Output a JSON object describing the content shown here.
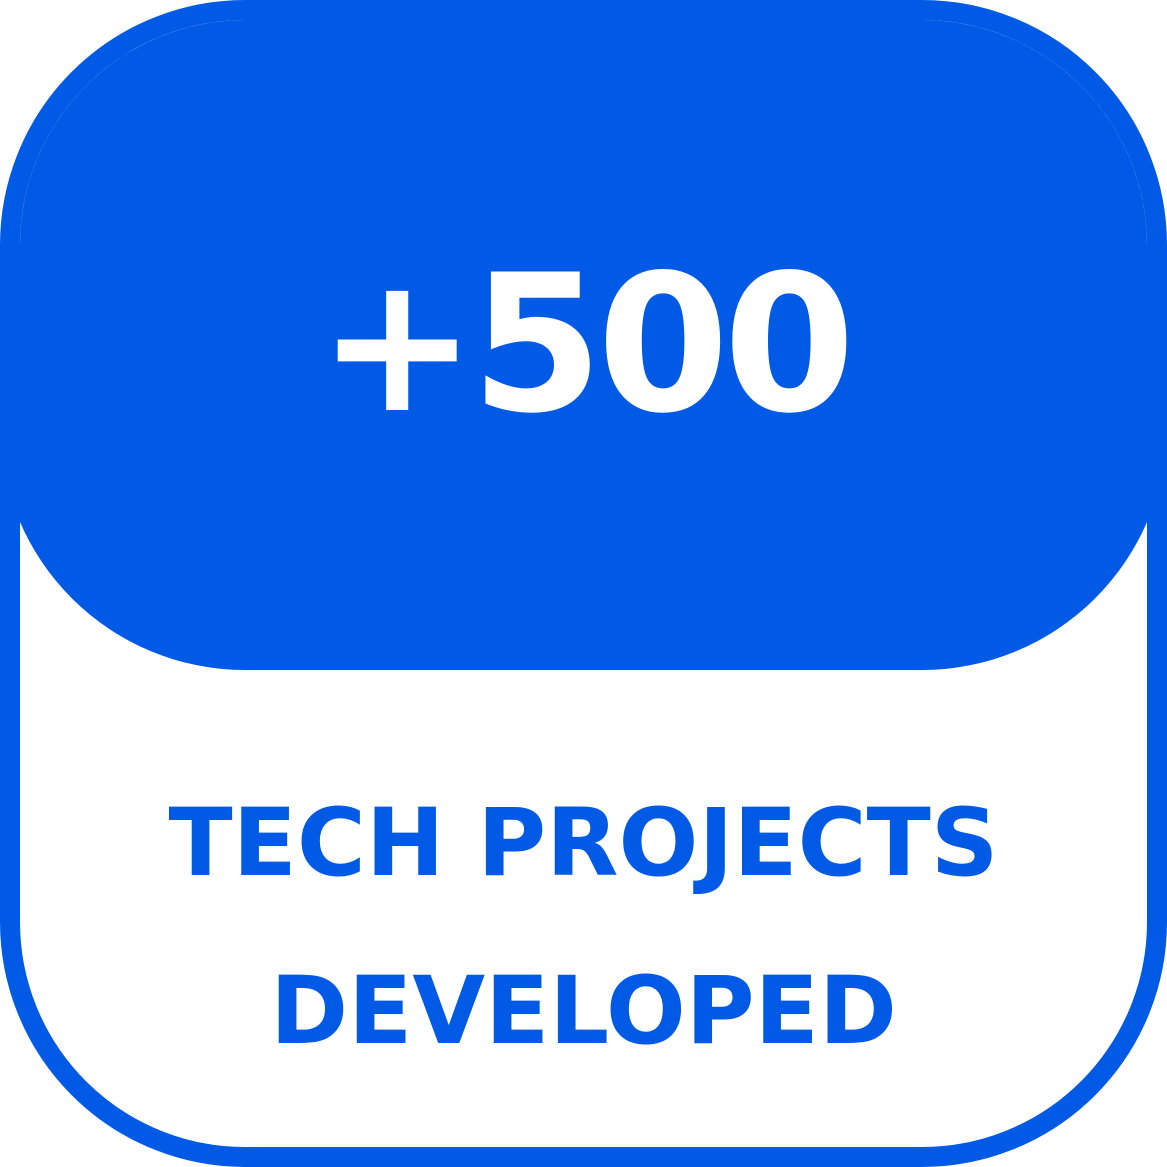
{
  "stat": {
    "value": "+500",
    "label_line1": "TECH PROJECTS",
    "label_line2": "DEVELOPED"
  },
  "colors": {
    "accent": "#005ae5",
    "text_on_accent": "#ffffff",
    "background": "#ffffff"
  }
}
